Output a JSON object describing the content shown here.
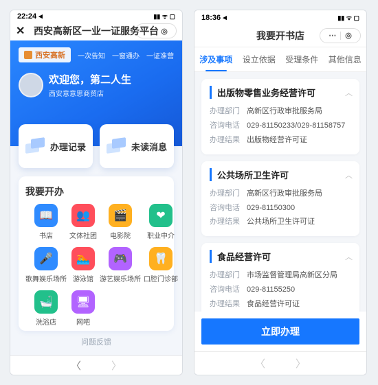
{
  "colors": {
    "primary": "#1677ff",
    "hero1": "#2a87ff",
    "hero2": "#1558d6"
  },
  "left": {
    "status": {
      "time": "22:24 ◂",
      "indicators": "▮▮ ᯤ ▢"
    },
    "nav": {
      "close": "✕",
      "title": "西安高新区一业一证服务平台",
      "capsule_more": "⋯",
      "capsule_close": "◎"
    },
    "hero": {
      "brand_text": "西安高新",
      "slogan": "一次告知　一窗通办　一证准营",
      "welcome": "欢迎您，第二人生",
      "org": "西安意意思商贸店"
    },
    "mcards": {
      "history": "办理记录",
      "messages": "未读消息"
    },
    "panel_title": "我要开办",
    "apps": [
      {
        "label": "书店",
        "icon": "📖",
        "bg": "#2f8bff"
      },
      {
        "label": "文体社团",
        "icon": "👥",
        "bg": "#ff4e5b"
      },
      {
        "label": "电影院",
        "icon": "🎬",
        "bg": "#ffb020"
      },
      {
        "label": "职业中介",
        "icon": "❤",
        "bg": "#22c08b"
      },
      {
        "label": "歌舞娱乐场所",
        "icon": "🎤",
        "bg": "#2f8bff"
      },
      {
        "label": "游泳馆",
        "icon": "🏊",
        "bg": "#ff4e5b"
      },
      {
        "label": "游艺娱乐场所",
        "icon": "🎮",
        "bg": "#b263ff"
      },
      {
        "label": "口腔门诊部",
        "icon": "🦷",
        "bg": "#ffb020"
      },
      {
        "label": "洗浴店",
        "icon": "🛁",
        "bg": "#22c08b"
      },
      {
        "label": "网吧",
        "icon": "🖥",
        "bg": "#b263ff"
      }
    ],
    "feedback": "问题反馈",
    "bnav": {
      "back": "〈",
      "fwd": "〉"
    }
  },
  "right": {
    "status": {
      "time": "18:36 ◂",
      "indicators": "▮▮ ᯤ ▢"
    },
    "nav": {
      "title": "我要开书店",
      "capsule_more": "⋯",
      "capsule_close": "◎"
    },
    "tabs": [
      {
        "label": "涉及事项",
        "active": true
      },
      {
        "label": "设立依据",
        "active": false
      },
      {
        "label": "受理条件",
        "active": false
      },
      {
        "label": "其他信息",
        "active": false
      }
    ],
    "klabels": {
      "dept": "办理部门",
      "phone": "咨询电话",
      "result": "办理结果"
    },
    "cards": [
      {
        "title": "出版物零售业务经营许可",
        "dept": "高新区行政审批服务局",
        "phone": "029-81150233/029-81158757",
        "result": "出版物经营许可证"
      },
      {
        "title": "公共场所卫生许可",
        "dept": "高新区行政审批服务局",
        "phone": "029-81150300",
        "result": "公共场所卫生许可证"
      },
      {
        "title": "食品经营许可",
        "dept": "市场监督管理局高新区分局",
        "phone": "029-81155250",
        "result": "食品经营许可证"
      }
    ],
    "cta": "立即办理",
    "bnav": {
      "back": "〈",
      "fwd": "〉"
    }
  }
}
